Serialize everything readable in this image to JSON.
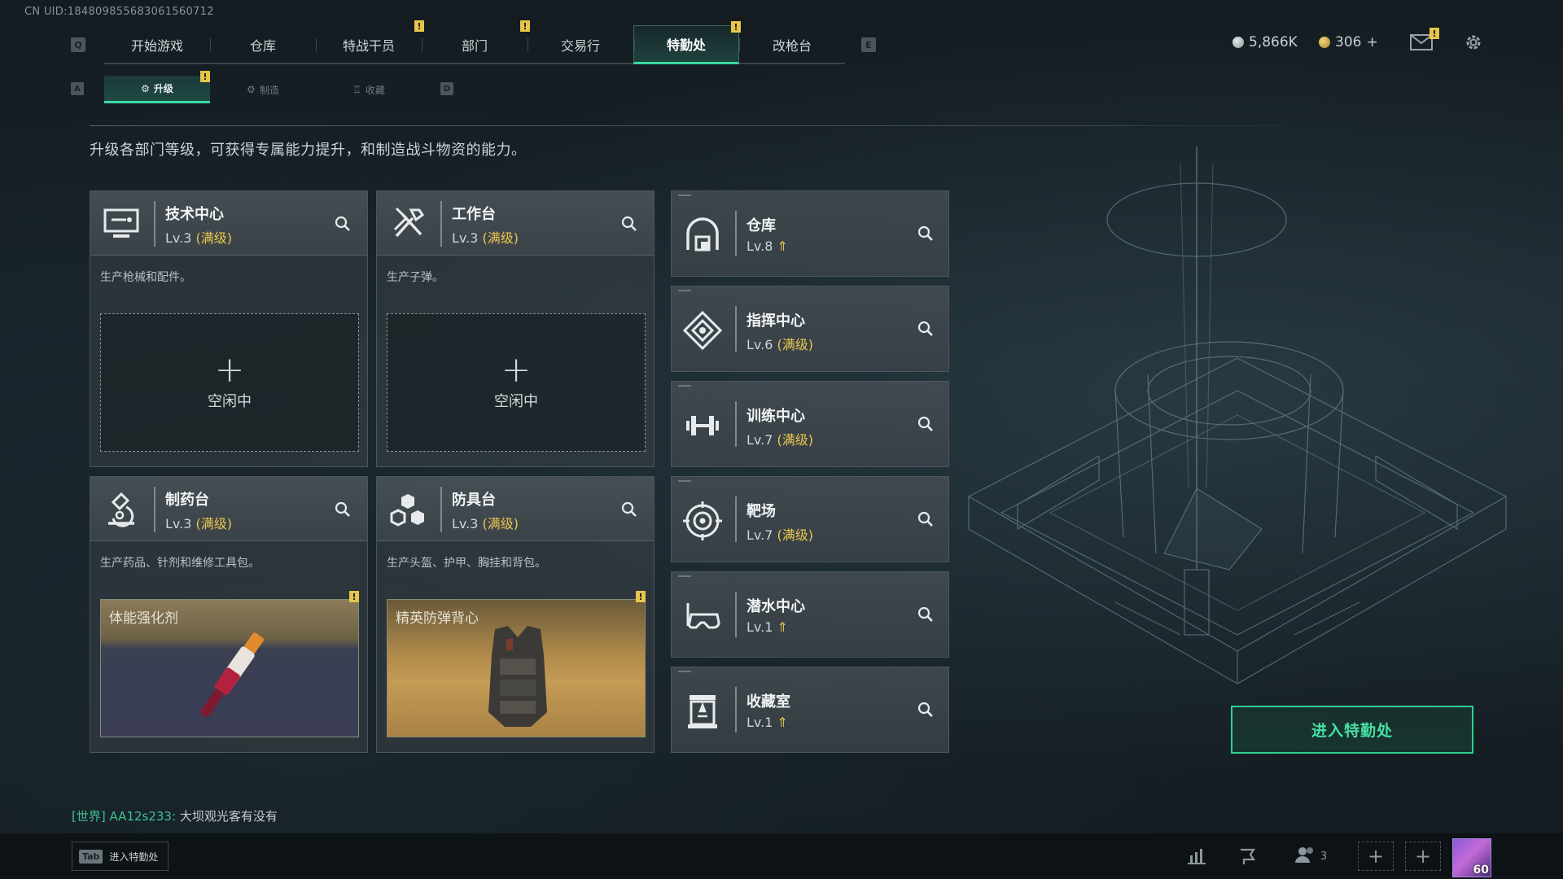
{
  "uid": "CN UID:18480985568306156071​2",
  "topnav": {
    "left_key": "Q",
    "right_key": "E",
    "tabs": [
      {
        "label": "开始游戏",
        "active": false,
        "badge": false
      },
      {
        "label": "仓库",
        "active": false,
        "badge": false
      },
      {
        "label": "特战干员",
        "active": false,
        "badge": true
      },
      {
        "label": "部门",
        "active": false,
        "badge": true
      },
      {
        "label": "交易行",
        "active": false,
        "badge": false
      },
      {
        "label": "特勤处",
        "active": true,
        "badge": true
      },
      {
        "label": "改枪台",
        "active": false,
        "badge": false
      }
    ],
    "badge_text": "!"
  },
  "currency": {
    "silver": "5,866K",
    "gold": "306",
    "gold_add": "+"
  },
  "subnav": {
    "left_key": "A",
    "right_key": "D",
    "tabs": [
      {
        "label": "升级",
        "active": true
      },
      {
        "label": "制造",
        "active": false
      },
      {
        "label": "收藏",
        "active": false
      }
    ]
  },
  "description": "升级各部门等级，可获得专属能力提升，和制造战斗物资的能力。",
  "left_cards": [
    {
      "name": "技术中心",
      "level": "Lv.3",
      "max": "(满级)",
      "desc": "生产枪械和配件。",
      "slot": {
        "plus": "+",
        "status": "空闲中"
      },
      "icon": "monitor-icon"
    },
    {
      "name": "工作台",
      "level": "Lv.3",
      "max": "(满级)",
      "desc": "生产子弹。",
      "slot": {
        "plus": "+",
        "status": "空闲中"
      },
      "icon": "hammer-icon"
    },
    {
      "name": "制药台",
      "level": "Lv.3",
      "max": "(满级)",
      "desc": "生产药品、针剂和维修工具包。",
      "product": "体能强化剂",
      "icon": "microscope-icon"
    },
    {
      "name": "防具台",
      "level": "Lv.3",
      "max": "(满级)",
      "desc": "生产头盔、护甲、胸挂和背包。",
      "product": "精英防弹背心",
      "icon": "cubes-icon"
    }
  ],
  "right_cards": [
    {
      "name": "仓库",
      "level": "Lv.8",
      "max": "",
      "upgradable": true,
      "icon": "warehouse-icon"
    },
    {
      "name": "指挥中心",
      "level": "Lv.6",
      "max": "(满级)",
      "upgradable": false,
      "icon": "command-icon"
    },
    {
      "name": "训练中心",
      "level": "Lv.7",
      "max": "(满级)",
      "upgradable": false,
      "icon": "dumbbell-icon"
    },
    {
      "name": "靶场",
      "level": "Lv.7",
      "max": "(满级)",
      "upgradable": false,
      "icon": "target-icon"
    },
    {
      "name": "潜水中心",
      "level": "Lv.1",
      "max": "",
      "upgradable": true,
      "icon": "diving-mask-icon"
    },
    {
      "name": "收藏室",
      "level": "Lv.1",
      "max": "",
      "upgradable": true,
      "icon": "trophy-case-icon"
    }
  ],
  "enter_button": "进入特勤处",
  "chat": {
    "channel": "[世界]",
    "user": "AA12s233:",
    "message": "大坝观光客有没有"
  },
  "bottom": {
    "tab_key": "Tab",
    "tab_label": "进入特勤处",
    "friends_count": "3",
    "avatar_level": "60"
  },
  "colors": {
    "accent": "#3fd6a3",
    "max_level": "#e9c64d",
    "badge": "#e6c64a"
  }
}
